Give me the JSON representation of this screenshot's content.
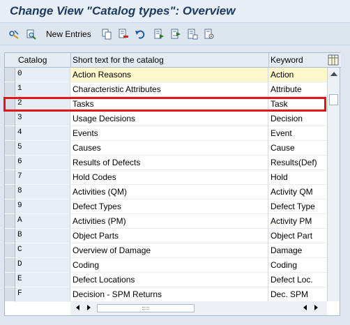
{
  "window": {
    "title": "Change View \"Catalog types\": Overview"
  },
  "toolbar": {
    "new_entries_label": "New Entries",
    "icons": [
      "display-change-icon",
      "other-view-icon",
      "copy-icon",
      "delete-icon",
      "undo-icon",
      "select-all-icon",
      "select-block-icon",
      "deselect-all-icon",
      "config-icon"
    ]
  },
  "table": {
    "columns": {
      "catalog": "Catalog",
      "short_text": "Short text for the catalog",
      "keyword": "Keyword"
    },
    "rows": [
      {
        "catalog": "0",
        "text": "Action Reasons",
        "keyword": "Action"
      },
      {
        "catalog": "1",
        "text": "Characteristic Attributes",
        "keyword": "Attribute"
      },
      {
        "catalog": "2",
        "text": "Tasks",
        "keyword": "Task"
      },
      {
        "catalog": "3",
        "text": "Usage Decisions",
        "keyword": "Decision"
      },
      {
        "catalog": "4",
        "text": "Events",
        "keyword": "Event"
      },
      {
        "catalog": "5",
        "text": "Causes",
        "keyword": "Cause"
      },
      {
        "catalog": "6",
        "text": "Results of Defects",
        "keyword": "Results(Def)"
      },
      {
        "catalog": "7",
        "text": "Hold Codes",
        "keyword": "Hold"
      },
      {
        "catalog": "8",
        "text": "Activities (QM)",
        "keyword": "Activity QM"
      },
      {
        "catalog": "9",
        "text": "Defect Types",
        "keyword": "Defect Type"
      },
      {
        "catalog": "A",
        "text": "Activities (PM)",
        "keyword": "Activity PM"
      },
      {
        "catalog": "B",
        "text": "Object Parts",
        "keyword": "Object Part"
      },
      {
        "catalog": "C",
        "text": "Overview of Damage",
        "keyword": "Damage"
      },
      {
        "catalog": "D",
        "text": "Coding",
        "keyword": "Coding"
      },
      {
        "catalog": "E",
        "text": "Defect Locations",
        "keyword": "Defect Loc."
      },
      {
        "catalog": "F",
        "text": "Decision - SPM Returns",
        "keyword": "Dec. SPM"
      }
    ]
  },
  "colors": {
    "highlight": "#e0161b",
    "active_row": "#fff8cc",
    "title": "#1d3a63"
  }
}
